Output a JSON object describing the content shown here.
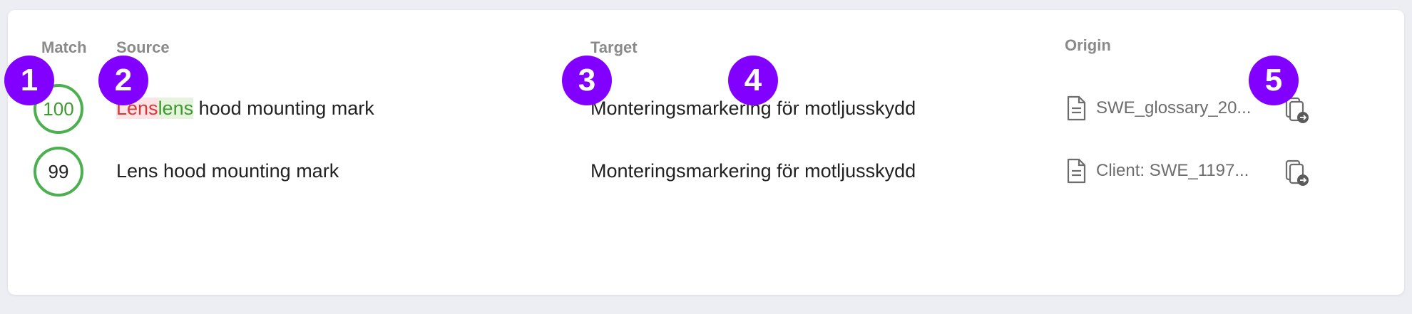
{
  "headers": {
    "match": "Match",
    "source": "Source",
    "target": "Target",
    "origin": "Origin"
  },
  "rows": [
    {
      "match": "100",
      "source_deleted": "Lens",
      "source_inserted": "lens",
      "source_rest": " hood mounting mark",
      "target": "Monteringsmarkering för motljusskydd",
      "origin": "SWE_glossary_20..."
    },
    {
      "match": "99",
      "source": "Lens hood mounting mark",
      "target": "Monteringsmarkering för motljusskydd",
      "origin": "Client: SWE_1197..."
    }
  ],
  "badges": [
    "1",
    "2",
    "3",
    "4",
    "5"
  ],
  "colors": {
    "match_ring": "#4caf50",
    "match_100_text": "#3d9a2e",
    "deleted_text": "#d9383a",
    "deleted_bg": "#fde3e3",
    "inserted_text": "#3d9a2e",
    "inserted_bg": "#e6f4dd",
    "badge": "#8200ff"
  },
  "icons": {
    "origin": "document-icon",
    "action": "copy-to-target-icon"
  }
}
